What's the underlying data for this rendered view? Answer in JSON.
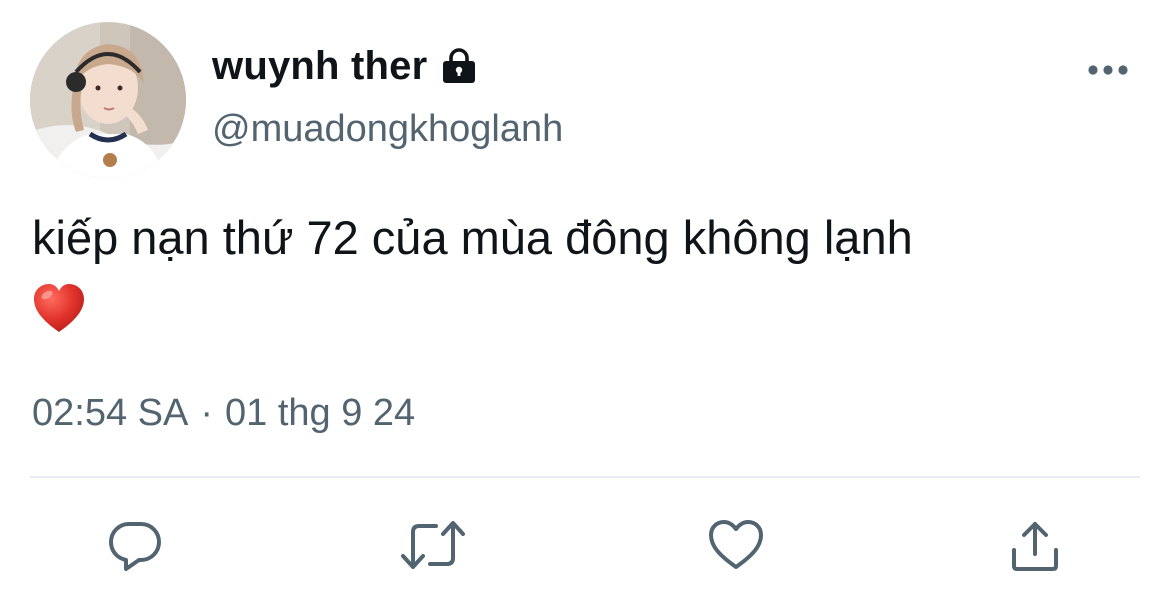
{
  "tweet": {
    "display_name": "wuynh ther",
    "handle": "@muadongkhoglanh",
    "text": "kiếp nạn thứ 72 của mùa đông không lạnh",
    "emoji": "heart-emoji",
    "time": "02:54 SA",
    "separator": "·",
    "date": "01 thg 9 24",
    "protected_icon": "lock-icon",
    "more_icon": "more-horizontal-icon"
  },
  "actions": {
    "reply_icon": "reply-icon",
    "retweet_icon": "retweet-icon",
    "like_icon": "heart-outline-icon",
    "share_icon": "share-icon"
  },
  "colors": {
    "text_primary": "#0f1419",
    "text_secondary": "#536471",
    "icon_gray": "#536471",
    "divider": "#e6ecf0",
    "heart_red": "#e0322b"
  }
}
